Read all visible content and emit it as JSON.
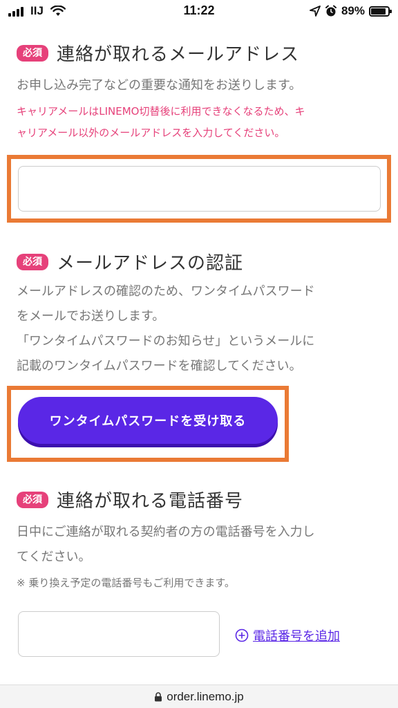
{
  "status_bar": {
    "carrier": "IIJ",
    "time": "11:22",
    "battery": "89%",
    "battery_level": 0.89
  },
  "email_section": {
    "badge": "必須",
    "title": "連絡が取れるメールアドレス",
    "description": "お申し込み完了などの重要な通知をお送りします。",
    "warning_line1": "キャリアメールはLINEMO切替後に利用できなくなるため、キ",
    "warning_line2": "ャリアメール以外のメールアドレスを入力してください。",
    "value": "",
    "placeholder": ""
  },
  "auth_section": {
    "badge": "必須",
    "title": "メールアドレスの認証",
    "desc_line1": "メールアドレスの確認のため、ワンタイムパスワード",
    "desc_line2": "をメールでお送りします。",
    "desc_line3": "「ワンタイムパスワードのお知らせ」というメールに",
    "desc_line4": "記載のワンタイムパスワードを確認してください。",
    "button_label": "ワンタイムパスワードを受け取る"
  },
  "phone_section": {
    "badge": "必須",
    "title": "連絡が取れる電話番号",
    "desc_line1": "日中にご連絡が取れる契約者の方の電話番号を入力し",
    "desc_line2": "てください。",
    "note": "※ 乗り換え予定の電話番号もご利用できます。",
    "value": "",
    "placeholder": "",
    "add_label": "電話番号を追加"
  },
  "url_bar": {
    "url": "order.linemo.jp"
  },
  "colors": {
    "accent_purple": "#5a27e6",
    "required_pink": "#e6417a",
    "highlight_orange": "#ea7a35"
  }
}
